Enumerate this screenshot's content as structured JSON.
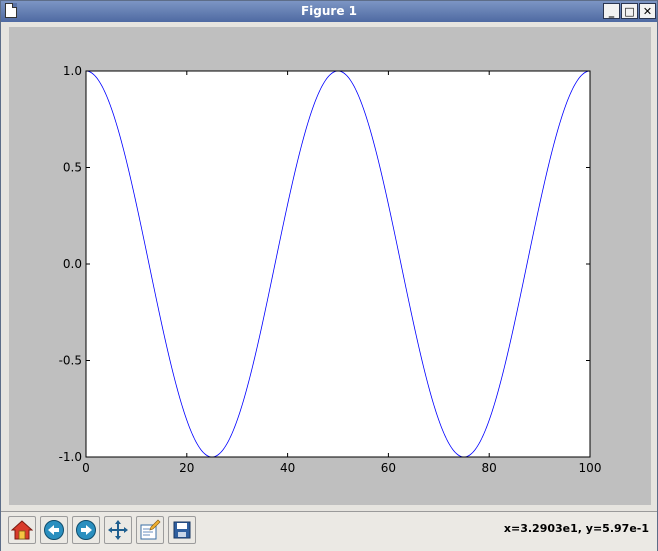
{
  "window": {
    "title": "Figure 1"
  },
  "window_controls": {
    "minimize": "_",
    "maximize": "□",
    "close": "✕"
  },
  "toolbar": {
    "buttons": [
      {
        "icon": "home-icon",
        "tooltip": "Home"
      },
      {
        "icon": "back-arrow-icon",
        "tooltip": "Back"
      },
      {
        "icon": "forward-arrow-icon",
        "tooltip": "Forward"
      },
      {
        "icon": "pan-move-icon",
        "tooltip": "Pan"
      },
      {
        "icon": "zoom-rect-icon",
        "tooltip": "Zoom"
      },
      {
        "icon": "save-icon",
        "tooltip": "Save"
      }
    ],
    "coords": "x=3.2903e1, y=5.97e-1"
  },
  "colors": {
    "line": "#0000ff",
    "figure_bg": "#bfbfbf",
    "axes_bg": "#ffffff",
    "titlebar": "#5a74a8"
  },
  "chart_data": {
    "type": "line",
    "function": "cos(2*pi*x/50)",
    "x": [
      0,
      2.5,
      5,
      7.5,
      10,
      12.5,
      15,
      17.5,
      20,
      22.5,
      25,
      27.5,
      30,
      32.5,
      35,
      37.5,
      40,
      42.5,
      45,
      47.5,
      50,
      52.5,
      55,
      57.5,
      60,
      62.5,
      65,
      67.5,
      70,
      72.5,
      75,
      77.5,
      80,
      82.5,
      85,
      87.5,
      90,
      92.5,
      95,
      97.5,
      100
    ],
    "y": [
      1.0,
      0.951,
      0.809,
      0.588,
      0.309,
      0.0,
      -0.309,
      -0.588,
      -0.809,
      -0.951,
      -1.0,
      -0.951,
      -0.809,
      -0.588,
      -0.309,
      0.0,
      0.309,
      0.588,
      0.809,
      0.951,
      1.0,
      0.951,
      0.809,
      0.588,
      0.309,
      0.0,
      -0.309,
      -0.588,
      -0.809,
      -0.951,
      -1.0,
      -0.951,
      -0.809,
      -0.588,
      -0.309,
      0.0,
      0.309,
      0.588,
      0.809,
      0.951,
      1.0
    ],
    "xlim": [
      0,
      100
    ],
    "ylim": [
      -1.0,
      1.0
    ],
    "xticks": [
      0,
      20,
      40,
      60,
      80,
      100
    ],
    "xtick_labels": [
      "0",
      "20",
      "40",
      "60",
      "80",
      "100"
    ],
    "yticks": [
      1.0,
      0.5,
      0.0,
      -0.5,
      -1.0
    ],
    "ytick_labels": [
      "1.0",
      "0.5",
      "0.0",
      "-0.5",
      "-1.0"
    ],
    "grid": false,
    "title": "",
    "xlabel": "",
    "ylabel": ""
  }
}
